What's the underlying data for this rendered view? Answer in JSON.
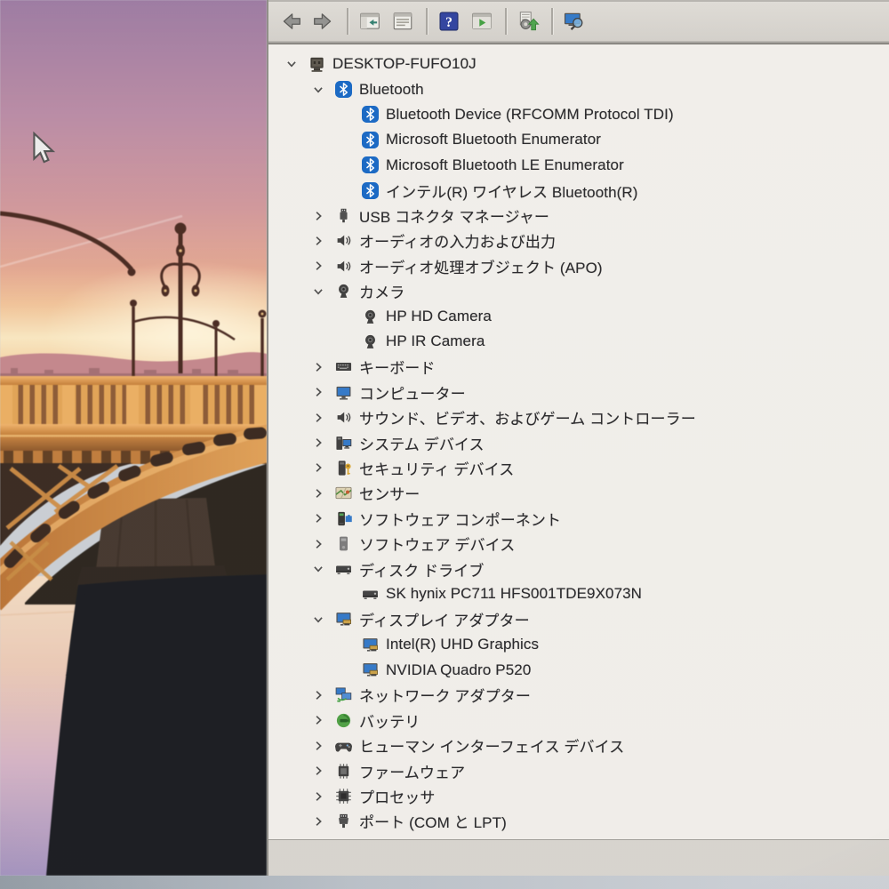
{
  "device_manager": {
    "toolbar": {
      "buttons": [
        {
          "name": "back",
          "icon": "back-icon"
        },
        {
          "name": "forward",
          "icon": "forward-icon"
        },
        {
          "type": "separator"
        },
        {
          "name": "show-console-tree",
          "icon": "show-console-tree-icon"
        },
        {
          "name": "properties",
          "icon": "properties-icon"
        },
        {
          "type": "separator"
        },
        {
          "name": "help",
          "icon": "help-icon"
        },
        {
          "name": "action-pane",
          "icon": "action-pane-icon"
        },
        {
          "type": "separator"
        },
        {
          "name": "update-driver",
          "icon": "update-driver-icon"
        },
        {
          "type": "separator"
        },
        {
          "name": "scan-hardware-changes",
          "icon": "scan-hardware-icon"
        }
      ]
    },
    "tree": {
      "items": [
        {
          "id": "root-computer",
          "label": "DESKTOP-FUFO10J",
          "level": 0,
          "state": "expanded",
          "icon": "computer"
        },
        {
          "id": "bluetooth-group",
          "label": "Bluetooth",
          "level": 1,
          "state": "expanded",
          "icon": "bluetooth"
        },
        {
          "id": "bluetooth-rfcomm",
          "label": "Bluetooth Device (RFCOMM Protocol TDI)",
          "level": 2,
          "state": "leaf",
          "icon": "bluetooth"
        },
        {
          "id": "ms-bluetooth-enumerator",
          "label": "Microsoft Bluetooth Enumerator",
          "level": 2,
          "state": "leaf",
          "icon": "bluetooth"
        },
        {
          "id": "ms-bluetooth-le-enumerator",
          "label": "Microsoft Bluetooth LE Enumerator",
          "level": 2,
          "state": "leaf",
          "icon": "bluetooth"
        },
        {
          "id": "intel-wireless-bluetooth",
          "label": "インテル(R) ワイヤレス Bluetooth(R)",
          "level": 2,
          "state": "leaf",
          "icon": "bluetooth"
        },
        {
          "id": "usb-connector-manager",
          "label": "USB コネクタ マネージャー",
          "level": 1,
          "state": "collapsed",
          "icon": "usb"
        },
        {
          "id": "audio-inputs-outputs",
          "label": "オーディオの入力および出力",
          "level": 1,
          "state": "collapsed",
          "icon": "audio"
        },
        {
          "id": "audio-processing-objects",
          "label": "オーディオ処理オブジェクト (APO)",
          "level": 1,
          "state": "collapsed",
          "icon": "audio"
        },
        {
          "id": "cameras-group",
          "label": "カメラ",
          "level": 1,
          "state": "expanded",
          "icon": "camera"
        },
        {
          "id": "hp-hd-camera",
          "label": "HP HD Camera",
          "level": 2,
          "state": "leaf",
          "icon": "camera"
        },
        {
          "id": "hp-ir-camera",
          "label": "HP IR Camera",
          "level": 2,
          "state": "leaf",
          "icon": "camera"
        },
        {
          "id": "keyboards",
          "label": "キーボード",
          "level": 1,
          "state": "collapsed",
          "icon": "keyboard"
        },
        {
          "id": "computer-group",
          "label": "コンピューター",
          "level": 1,
          "state": "collapsed",
          "icon": "monitor"
        },
        {
          "id": "sound-video-game-controllers",
          "label": "サウンド、ビデオ、およびゲーム コントローラー",
          "level": 1,
          "state": "collapsed",
          "icon": "audio"
        },
        {
          "id": "system-devices",
          "label": "システム デバイス",
          "level": 1,
          "state": "collapsed",
          "icon": "system"
        },
        {
          "id": "security-devices",
          "label": "セキュリティ デバイス",
          "level": 1,
          "state": "collapsed",
          "icon": "security"
        },
        {
          "id": "sensors",
          "label": "センサー",
          "level": 1,
          "state": "collapsed",
          "icon": "sensor"
        },
        {
          "id": "software-components",
          "label": "ソフトウェア コンポーネント",
          "level": 1,
          "state": "collapsed",
          "icon": "software-component"
        },
        {
          "id": "software-devices",
          "label": "ソフトウェア デバイス",
          "level": 1,
          "state": "collapsed",
          "icon": "software-device"
        },
        {
          "id": "disk-drives-group",
          "label": "ディスク ドライブ",
          "level": 1,
          "state": "expanded",
          "icon": "disk"
        },
        {
          "id": "sk-hynix-ssd",
          "label": "SK hynix PC711 HFS001TDE9X073N",
          "level": 2,
          "state": "leaf",
          "icon": "disk"
        },
        {
          "id": "display-adapters-group",
          "label": "ディスプレイ アダプター",
          "level": 1,
          "state": "expanded",
          "icon": "display"
        },
        {
          "id": "intel-uhd-graphics",
          "label": "Intel(R) UHD Graphics",
          "level": 2,
          "state": "leaf",
          "icon": "display"
        },
        {
          "id": "nvidia-quadro-p520",
          "label": "NVIDIA Quadro P520",
          "level": 2,
          "state": "leaf",
          "icon": "display"
        },
        {
          "id": "network-adapters",
          "label": "ネットワーク アダプター",
          "level": 1,
          "state": "collapsed",
          "icon": "network"
        },
        {
          "id": "batteries",
          "label": "バッテリ",
          "level": 1,
          "state": "collapsed",
          "icon": "battery"
        },
        {
          "id": "human-interface-devices",
          "label": "ヒューマン インターフェイス デバイス",
          "level": 1,
          "state": "collapsed",
          "icon": "hid"
        },
        {
          "id": "firmware",
          "label": "ファームウェア",
          "level": 1,
          "state": "collapsed",
          "icon": "firmware"
        },
        {
          "id": "processors",
          "label": "プロセッサ",
          "level": 1,
          "state": "collapsed",
          "icon": "processor"
        },
        {
          "id": "ports-com-lpt",
          "label": "ポート (COM と LPT)",
          "level": 1,
          "state": "collapsed",
          "icon": "ports"
        },
        {
          "id": "partial-item",
          "label": "",
          "level": 1,
          "state": "leaf",
          "icon": "clipped"
        }
      ]
    }
  },
  "cursor": {
    "type": "arrow"
  },
  "colors": {
    "bluetooth_blue": "#1365c4",
    "help_icon_blue": "#2c3f9e",
    "toolbar_background": "#d6d3ce",
    "tree_background": "#f1efeb",
    "window_border": "#8d8b86",
    "bezel_grey": "#b4bcc4"
  }
}
